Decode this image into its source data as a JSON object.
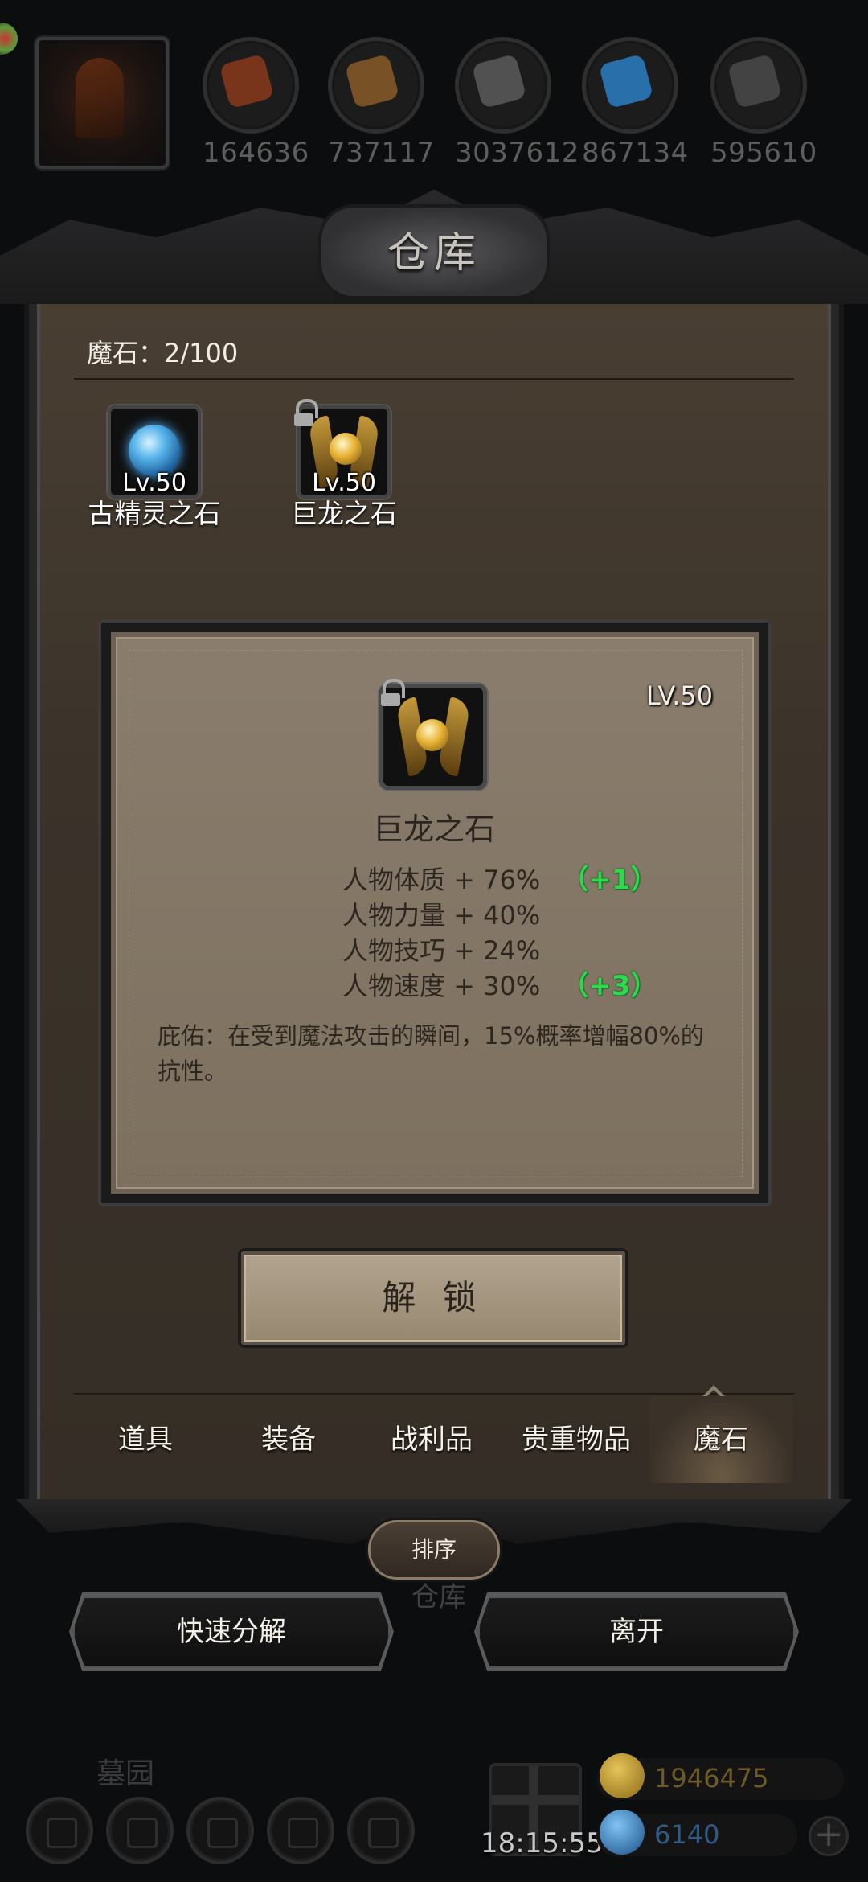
{
  "resources": [
    {
      "value": "164636",
      "icon": "meat-icon",
      "color": "#8a3a1c"
    },
    {
      "value": "737117",
      "icon": "wood-icon",
      "color": "#8a5a28"
    },
    {
      "value": "3037612",
      "icon": "iron-icon",
      "color": "#5a5a5a"
    },
    {
      "value": "867134",
      "icon": "crystal-icon",
      "color": "#2b7fc4"
    },
    {
      "value": "595610",
      "icon": "stone-icon",
      "color": "#4a4a4a"
    }
  ],
  "panel": {
    "title": "仓库",
    "count_label": "魔石：2/100"
  },
  "items": [
    {
      "name": "古精灵之石",
      "level": "Lv.50",
      "locked": false
    },
    {
      "name": "巨龙之石",
      "level": "Lv.50",
      "locked": true
    }
  ],
  "detail": {
    "level": "LV.50",
    "name": "巨龙之石",
    "stats": [
      {
        "text": "人物体质 + 76%",
        "bonus": "（+1）"
      },
      {
        "text": "人物力量 + 40%",
        "bonus": ""
      },
      {
        "text": "人物技巧 + 24%",
        "bonus": ""
      },
      {
        "text": "人物速度 + 30%",
        "bonus": "（+3）"
      }
    ],
    "description": "庇佑：在受到魔法攻击的瞬间，15%概率增幅80%的抗性。"
  },
  "unlock_label": "解 锁",
  "tabs": [
    "道具",
    "装备",
    "战利品",
    "贵重物品",
    "魔石"
  ],
  "active_tab": "魔石",
  "sort_label": "排序",
  "ghost_label": "仓库",
  "quick_decompose_label": "快速分解",
  "leave_label": "离开",
  "bottom": {
    "location": "墓园",
    "time": "18:15:55",
    "gold": "1946475",
    "gems": "6140"
  },
  "colors": {
    "bonus_green": "#31d84c",
    "gold": "#c29a2c",
    "gem_blue": "#3a8fd6"
  }
}
